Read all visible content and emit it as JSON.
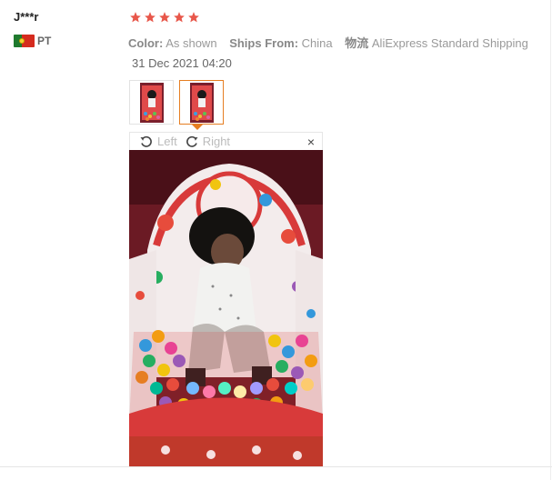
{
  "review": {
    "username": "J***r",
    "country_code": "PT",
    "rating": 5,
    "color_label": "Color:",
    "color_value": "As shown",
    "ships_label": "Ships From:",
    "ships_value": "China",
    "logistics_label": "物流",
    "logistics_value": "AliExpress Standard Shipping",
    "date": "31 Dec 2021 04:20"
  },
  "viewer": {
    "rotate_left_label": "Left",
    "rotate_right_label": "Right",
    "close_symbol": "×"
  },
  "colors": {
    "star": "#e8574a",
    "accent": "#e67e22",
    "label_gray": "#999999"
  }
}
